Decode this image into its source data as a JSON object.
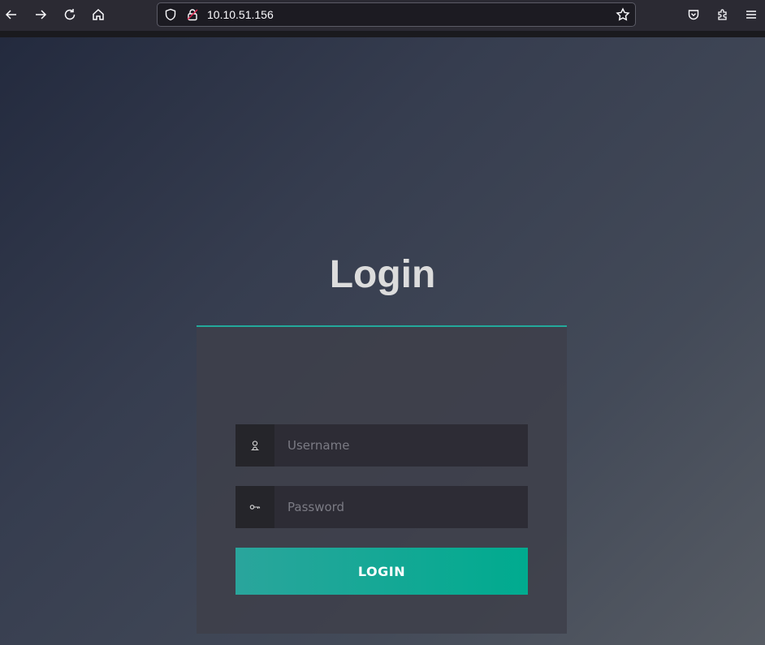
{
  "browser": {
    "url": "10.10.51.156",
    "icons": {
      "back": "arrow-left-icon",
      "forward": "arrow-right-icon",
      "reload": "reload-icon",
      "home": "home-icon",
      "shield": "shield-icon",
      "lock": "insecure-lock-icon",
      "bookmark": "star-icon",
      "pocket": "pocket-icon",
      "extensions": "puzzle-icon",
      "menu": "hamburger-menu-icon"
    }
  },
  "login": {
    "title": "Login",
    "username_placeholder": "Username",
    "password_placeholder": "Password",
    "button_label": "LOGIN",
    "icons": {
      "username": "user-icon",
      "password": "key-icon"
    }
  },
  "colors": {
    "accent": "#23a99b",
    "button_start": "#2aa59c",
    "button_end": "#00ab8f"
  }
}
